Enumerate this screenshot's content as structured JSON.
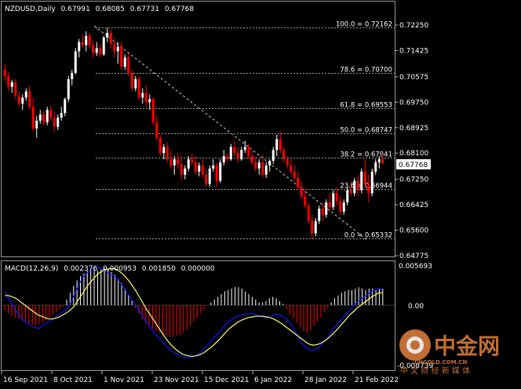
{
  "symbol_info": {
    "symbol": "NZDUSD,Daily",
    "open": "0.67991",
    "high": "0.68085",
    "low": "0.67731",
    "close": "0.67768"
  },
  "indicator": {
    "title": "MACD(12,26,9)",
    "values": [
      "0.002376",
      "0.000953",
      "0.001850",
      "0.000000"
    ],
    "axis_labels": [
      "0.005693",
      "0.00",
      "-0.008739"
    ]
  },
  "fibonacci": [
    {
      "level": "100.0",
      "price": "0.72162"
    },
    {
      "level": "78.6",
      "price": "0.70700"
    },
    {
      "level": "61.8",
      "price": "0.69553"
    },
    {
      "level": "50.0",
      "price": "0.68747"
    },
    {
      "level": "38.2",
      "price": "0.67941"
    },
    {
      "level": "23.6",
      "price": "0.66944"
    },
    {
      "level": "0.0",
      "price": "0.65332"
    }
  ],
  "price_axis_labels": [
    "0.72250",
    "0.71425",
    "0.70575",
    "0.69750",
    "0.68925",
    "0.68100",
    "0.67250",
    "0.66425",
    "0.65600",
    "0.64775"
  ],
  "current_price": "0.67768",
  "date_labels": [
    "16 Sep 2021",
    "8 Oct 2021",
    "1 Nov 2021",
    "23 Nov 2021",
    "15 Dec 2021",
    "6 Jan 2022",
    "28 Jan 2022",
    "21 Feb 2022"
  ],
  "watermark": {
    "brand": "中金网",
    "url": "CNGOLD.COM.CN",
    "slogan": "中 文 财 经 新 媒 体"
  },
  "colors": {
    "bull": "#ffffff",
    "bear": "#ff0000",
    "macd_main": "#1414ff",
    "macd_signal": "#ffff66",
    "grid": "#ffffff",
    "price_tag": "#ffffff",
    "watermark": "#d87a3a"
  },
  "chart_data": [
    {
      "type": "candlestick",
      "title": "NZDUSD,Daily",
      "x_labels": [
        "16 Sep 2021",
        "8 Oct 2021",
        "1 Nov 2021",
        "23 Nov 2021",
        "15 Dec 2021",
        "6 Jan 2022",
        "28 Jan 2022",
        "21 Feb 2022"
      ],
      "ylim": [
        0.6465,
        0.724
      ],
      "ohlc": [
        [
          0.708,
          0.71,
          0.7045,
          0.706
        ],
        [
          0.706,
          0.7072,
          0.701,
          0.7025
        ],
        [
          0.7025,
          0.7048,
          0.7005,
          0.704
        ],
        [
          0.704,
          0.705,
          0.6985,
          0.6995
        ],
        [
          0.6995,
          0.701,
          0.696,
          0.697
        ],
        [
          0.697,
          0.7,
          0.695,
          0.699
        ],
        [
          0.699,
          0.702,
          0.698,
          0.701
        ],
        [
          0.701,
          0.703,
          0.695,
          0.696
        ],
        [
          0.696,
          0.699,
          0.688,
          0.689
        ],
        [
          0.689,
          0.693,
          0.686,
          0.6915
        ],
        [
          0.6915,
          0.695,
          0.6905,
          0.6935
        ],
        [
          0.6935,
          0.6945,
          0.69,
          0.691
        ],
        [
          0.691,
          0.696,
          0.69,
          0.695
        ],
        [
          0.695,
          0.6965,
          0.6915,
          0.6925
        ],
        [
          0.6925,
          0.6945,
          0.688,
          0.6895
        ],
        [
          0.6895,
          0.6935,
          0.6885,
          0.6925
        ],
        [
          0.6925,
          0.696,
          0.6915,
          0.694
        ],
        [
          0.694,
          0.699,
          0.693,
          0.6985
        ],
        [
          0.6985,
          0.706,
          0.6975,
          0.705
        ],
        [
          0.705,
          0.708,
          0.703,
          0.707
        ],
        [
          0.707,
          0.715,
          0.7065,
          0.714
        ],
        [
          0.714,
          0.718,
          0.712,
          0.717
        ],
        [
          0.717,
          0.7195,
          0.715,
          0.716
        ],
        [
          0.716,
          0.7205,
          0.714,
          0.719
        ],
        [
          0.719,
          0.72,
          0.715,
          0.716
        ],
        [
          0.716,
          0.7175,
          0.712,
          0.7135
        ],
        [
          0.7135,
          0.717,
          0.7125,
          0.715
        ],
        [
          0.715,
          0.7165,
          0.712,
          0.713
        ],
        [
          0.713,
          0.719,
          0.7125,
          0.7185
        ],
        [
          0.7185,
          0.7216,
          0.717,
          0.72
        ],
        [
          0.72,
          0.721,
          0.715,
          0.7165
        ],
        [
          0.7165,
          0.7185,
          0.712,
          0.714
        ],
        [
          0.714,
          0.717,
          0.71,
          0.7155
        ],
        [
          0.7155,
          0.717,
          0.708,
          0.709
        ],
        [
          0.709,
          0.713,
          0.708,
          0.712
        ],
        [
          0.712,
          0.7135,
          0.706,
          0.707
        ],
        [
          0.707,
          0.708,
          0.701,
          0.702
        ],
        [
          0.702,
          0.706,
          0.701,
          0.705
        ],
        [
          0.705,
          0.706,
          0.698,
          0.699
        ],
        [
          0.699,
          0.702,
          0.697,
          0.7005
        ],
        [
          0.7005,
          0.703,
          0.696,
          0.6975
        ],
        [
          0.6975,
          0.7,
          0.695,
          0.6985
        ],
        [
          0.6985,
          0.699,
          0.69,
          0.691
        ],
        [
          0.691,
          0.693,
          0.685,
          0.686
        ],
        [
          0.686,
          0.687,
          0.68,
          0.681
        ],
        [
          0.681,
          0.684,
          0.679,
          0.683
        ],
        [
          0.683,
          0.6845,
          0.678,
          0.679
        ],
        [
          0.679,
          0.682,
          0.676,
          0.677
        ],
        [
          0.677,
          0.68,
          0.674,
          0.679
        ],
        [
          0.679,
          0.681,
          0.676,
          0.6775
        ],
        [
          0.6775,
          0.68,
          0.672,
          0.674
        ],
        [
          0.674,
          0.677,
          0.6725,
          0.676
        ],
        [
          0.676,
          0.68,
          0.675,
          0.679
        ],
        [
          0.679,
          0.681,
          0.677,
          0.678
        ],
        [
          0.678,
          0.68,
          0.674,
          0.675
        ],
        [
          0.675,
          0.678,
          0.6735,
          0.677
        ],
        [
          0.677,
          0.679,
          0.673,
          0.674
        ],
        [
          0.674,
          0.676,
          0.67,
          0.671
        ],
        [
          0.671,
          0.677,
          0.67,
          0.676
        ],
        [
          0.676,
          0.679,
          0.675,
          0.677
        ],
        [
          0.677,
          0.678,
          0.67,
          0.672
        ],
        [
          0.672,
          0.679,
          0.6715,
          0.678
        ],
        [
          0.678,
          0.682,
          0.677,
          0.68
        ],
        [
          0.68,
          0.681,
          0.678,
          0.679
        ],
        [
          0.679,
          0.684,
          0.6785,
          0.683
        ],
        [
          0.683,
          0.685,
          0.68,
          0.681
        ],
        [
          0.681,
          0.683,
          0.678,
          0.679
        ],
        [
          0.679,
          0.683,
          0.6785,
          0.682
        ],
        [
          0.682,
          0.685,
          0.681,
          0.683
        ],
        [
          0.683,
          0.684,
          0.679,
          0.68
        ],
        [
          0.68,
          0.682,
          0.677,
          0.678
        ],
        [
          0.678,
          0.68,
          0.675,
          0.676
        ],
        [
          0.676,
          0.679,
          0.674,
          0.678
        ],
        [
          0.678,
          0.68,
          0.673,
          0.674
        ],
        [
          0.674,
          0.678,
          0.673,
          0.677
        ],
        [
          0.677,
          0.679,
          0.675,
          0.6785
        ],
        [
          0.6785,
          0.683,
          0.6775,
          0.682
        ],
        [
          0.682,
          0.687,
          0.68,
          0.6855
        ],
        [
          0.6855,
          0.688,
          0.681,
          0.682
        ],
        [
          0.682,
          0.683,
          0.678,
          0.679
        ],
        [
          0.679,
          0.68,
          0.676,
          0.677
        ],
        [
          0.677,
          0.679,
          0.674,
          0.675
        ],
        [
          0.675,
          0.677,
          0.672,
          0.673
        ],
        [
          0.673,
          0.675,
          0.669,
          0.67
        ],
        [
          0.67,
          0.672,
          0.666,
          0.667
        ],
        [
          0.667,
          0.669,
          0.663,
          0.664
        ],
        [
          0.664,
          0.665,
          0.658,
          0.659
        ],
        [
          0.659,
          0.661,
          0.6533,
          0.655
        ],
        [
          0.655,
          0.66,
          0.654,
          0.659
        ],
        [
          0.659,
          0.664,
          0.658,
          0.663
        ],
        [
          0.663,
          0.665,
          0.659,
          0.661
        ],
        [
          0.661,
          0.666,
          0.66,
          0.665
        ],
        [
          0.665,
          0.668,
          0.662,
          0.6635
        ],
        [
          0.6635,
          0.669,
          0.6625,
          0.668
        ],
        [
          0.668,
          0.67,
          0.664,
          0.6655
        ],
        [
          0.6655,
          0.667,
          0.661,
          0.662
        ],
        [
          0.662,
          0.666,
          0.661,
          0.665
        ],
        [
          0.665,
          0.67,
          0.664,
          0.669
        ],
        [
          0.669,
          0.672,
          0.667,
          0.668
        ],
        [
          0.668,
          0.673,
          0.667,
          0.672
        ],
        [
          0.672,
          0.674,
          0.667,
          0.669
        ],
        [
          0.669,
          0.676,
          0.668,
          0.675
        ],
        [
          0.675,
          0.679,
          0.67,
          0.671
        ],
        [
          0.671,
          0.674,
          0.665,
          0.668
        ],
        [
          0.668,
          0.676,
          0.667,
          0.675
        ],
        [
          0.675,
          0.679,
          0.674,
          0.678
        ],
        [
          0.678,
          0.68,
          0.676,
          0.679
        ],
        [
          0.679,
          0.6808,
          0.6773,
          0.6777
        ]
      ]
    },
    {
      "type": "bar",
      "title": "MACD(12,26,9)",
      "ylim": [
        -0.008739,
        0.005693
      ],
      "histogram": [
        -0.0008,
        -0.0012,
        -0.0015,
        -0.0018,
        -0.002,
        -0.0022,
        -0.0024,
        -0.0026,
        -0.0028,
        -0.003,
        -0.0028,
        -0.0025,
        -0.0022,
        -0.0018,
        -0.0014,
        -0.001,
        -0.0006,
        -0.0002,
        0.0008,
        0.0018,
        0.0028,
        0.0036,
        0.0042,
        0.0046,
        0.005,
        0.0052,
        0.0053,
        0.005,
        0.0052,
        0.0054,
        0.0052,
        0.0048,
        0.0044,
        0.0038,
        0.0032,
        0.0024,
        0.0016,
        0.0006,
        -0.0004,
        -0.0012,
        -0.002,
        -0.0026,
        -0.003,
        -0.0034,
        -0.0038,
        -0.004,
        -0.0043,
        -0.0045,
        -0.0046,
        -0.0046,
        -0.0044,
        -0.0043,
        -0.004,
        -0.0036,
        -0.003,
        -0.0024,
        -0.0018,
        -0.0012,
        -0.0006,
        0.0,
        0.0004,
        0.0008,
        0.0012,
        0.0016,
        0.002,
        0.0022,
        0.0024,
        0.0026,
        0.0026,
        0.0024,
        0.002,
        0.0016,
        0.0012,
        0.0008,
        0.0004,
        0.0004,
        0.0006,
        0.001,
        0.0012,
        0.001,
        0.0006,
        0.0002,
        -0.0006,
        -0.0014,
        -0.002,
        -0.0026,
        -0.0032,
        -0.0038,
        -0.004,
        -0.0036,
        -0.003,
        -0.0024,
        -0.0018,
        -0.001,
        -0.0004,
        0.0004,
        0.001,
        0.0014,
        0.0018,
        0.002,
        0.0022,
        0.0022,
        0.0024,
        0.0026,
        0.0024,
        0.0022,
        0.0024,
        0.0024,
        0.0022,
        0.0024,
        0.0024
      ],
      "main": [
        0.002,
        0.001,
        0.0,
        -0.0008,
        -0.0016,
        -0.0022,
        -0.0026,
        -0.003,
        -0.0032,
        -0.0034,
        -0.003,
        -0.0026,
        -0.0024,
        -0.002,
        -0.0016,
        -0.0012,
        -0.0008,
        -0.0004,
        0.0006,
        0.0018,
        0.003,
        0.004,
        0.0046,
        0.005,
        0.0054,
        0.0055,
        0.0054,
        0.005,
        0.0046,
        0.0044,
        0.004,
        0.0034,
        0.0026,
        0.0018,
        0.001,
        0.0002,
        -0.0006,
        -0.0014,
        -0.0022,
        -0.003,
        -0.0038,
        -0.0044,
        -0.005,
        -0.0056,
        -0.0062,
        -0.0066,
        -0.007,
        -0.0072,
        -0.0074,
        -0.0076,
        -0.0076,
        -0.0074,
        -0.0072,
        -0.0068,
        -0.0062,
        -0.0056,
        -0.005,
        -0.0044,
        -0.0038,
        -0.0032,
        -0.0026,
        -0.0022,
        -0.0018,
        -0.0016,
        -0.0014,
        -0.0013,
        -0.0012,
        -0.0012,
        -0.0014,
        -0.0016,
        -0.0018,
        -0.0018,
        -0.0016,
        -0.0014,
        -0.0014,
        -0.0016,
        -0.002,
        -0.0026,
        -0.0034,
        -0.0044,
        -0.0054,
        -0.006,
        -0.0064,
        -0.0066,
        -0.0064,
        -0.006,
        -0.0054,
        -0.0048,
        -0.004,
        -0.0032,
        -0.0026,
        -0.002,
        -0.0014,
        -0.0008,
        -0.0002,
        0.0004,
        0.0008,
        0.0012,
        0.0016,
        0.002,
        0.0022,
        0.0024,
        0.0024
      ],
      "signal": [
        0.0014,
        0.0014,
        0.0012,
        0.001,
        0.0006,
        0.0002,
        -0.0002,
        -0.0006,
        -0.001,
        -0.0014,
        -0.0016,
        -0.0018,
        -0.002,
        -0.002,
        -0.0019,
        -0.0017,
        -0.0014,
        -0.0011,
        -0.0007,
        -0.0002,
        0.0006,
        0.0014,
        0.0022,
        0.003,
        0.0036,
        0.0042,
        0.0047,
        0.005,
        0.0052,
        0.0053,
        0.0053,
        0.0051,
        0.0047,
        0.0042,
        0.0036,
        0.0029,
        0.0021,
        0.0012,
        0.0003,
        -0.0006,
        -0.0014,
        -0.0022,
        -0.003,
        -0.0038,
        -0.0046,
        -0.0053,
        -0.0059,
        -0.0064,
        -0.0068,
        -0.0071,
        -0.0073,
        -0.0074,
        -0.0074,
        -0.0073,
        -0.0071,
        -0.0068,
        -0.0064,
        -0.006,
        -0.0055,
        -0.005,
        -0.0044,
        -0.0038,
        -0.0033,
        -0.0029,
        -0.0025,
        -0.0022,
        -0.002,
        -0.0018,
        -0.0017,
        -0.0016,
        -0.0016,
        -0.0016,
        -0.0017,
        -0.0018,
        -0.002,
        -0.0023,
        -0.0026,
        -0.003,
        -0.0034,
        -0.0038,
        -0.0042,
        -0.0046,
        -0.005,
        -0.0054,
        -0.0057,
        -0.0058,
        -0.0057,
        -0.0055,
        -0.0052,
        -0.0048,
        -0.0043,
        -0.0038,
        -0.0032,
        -0.0026,
        -0.002,
        -0.0014,
        -0.0009,
        -0.0004,
        0.0,
        0.0004,
        0.0008,
        0.0012,
        0.0015,
        0.0018,
        0.0018
      ]
    }
  ]
}
